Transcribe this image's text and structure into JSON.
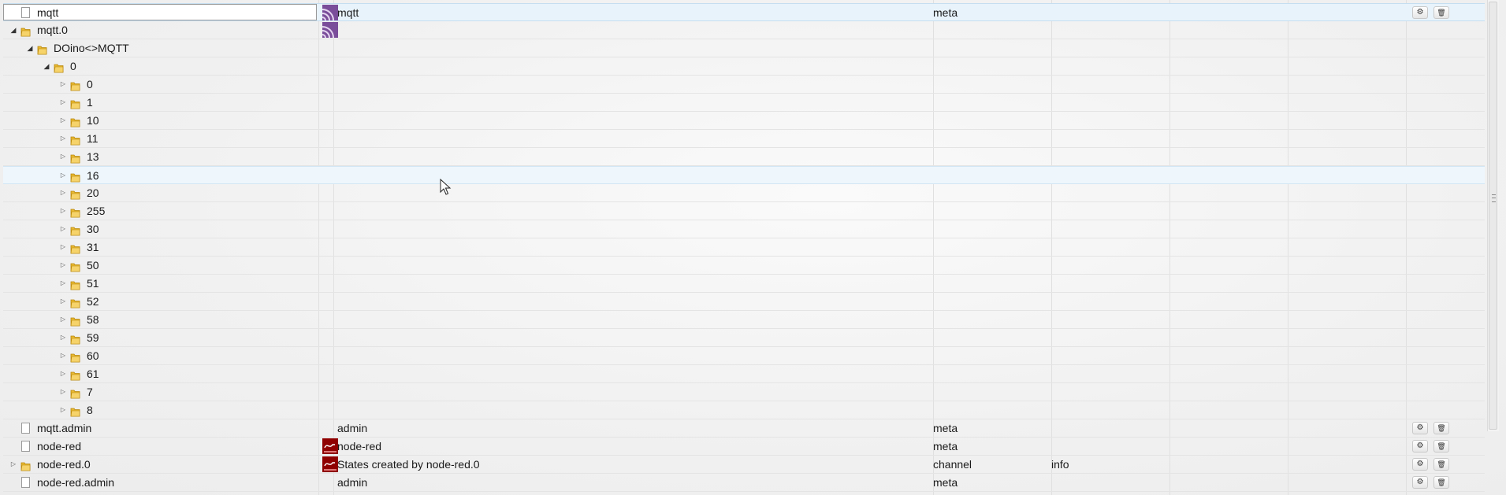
{
  "rows": [
    {
      "id": "mqtt",
      "name": "mqtt",
      "type": "meta",
      "role": "",
      "icon": "mqtt-adapter-icon",
      "kind": "file",
      "depth": 0,
      "expand": "none",
      "buttons": true,
      "state": "selected"
    },
    {
      "id": "mqtt.0",
      "name": "",
      "type": "",
      "role": "",
      "icon": "mqtt-adapter-icon",
      "kind": "folder",
      "depth": 0,
      "expand": "open",
      "buttons": false
    },
    {
      "id": "DOino<>MQTT",
      "name": "",
      "type": "",
      "role": "",
      "icon": "",
      "kind": "folder",
      "depth": 1,
      "expand": "open",
      "buttons": false
    },
    {
      "id": "0",
      "name": "",
      "type": "",
      "role": "",
      "icon": "",
      "kind": "folder",
      "depth": 2,
      "expand": "open",
      "buttons": false
    },
    {
      "id": "0",
      "kind": "folder",
      "depth": 3,
      "expand": "closed"
    },
    {
      "id": "1",
      "kind": "folder",
      "depth": 3,
      "expand": "closed"
    },
    {
      "id": "10",
      "kind": "folder",
      "depth": 3,
      "expand": "closed"
    },
    {
      "id": "11",
      "kind": "folder",
      "depth": 3,
      "expand": "closed"
    },
    {
      "id": "13",
      "kind": "folder",
      "depth": 3,
      "expand": "closed"
    },
    {
      "id": "16",
      "kind": "folder",
      "depth": 3,
      "expand": "closed",
      "state": "hover"
    },
    {
      "id": "20",
      "kind": "folder",
      "depth": 3,
      "expand": "closed"
    },
    {
      "id": "255",
      "kind": "folder",
      "depth": 3,
      "expand": "closed"
    },
    {
      "id": "30",
      "kind": "folder",
      "depth": 3,
      "expand": "closed"
    },
    {
      "id": "31",
      "kind": "folder",
      "depth": 3,
      "expand": "closed"
    },
    {
      "id": "50",
      "kind": "folder",
      "depth": 3,
      "expand": "closed"
    },
    {
      "id": "51",
      "kind": "folder",
      "depth": 3,
      "expand": "closed"
    },
    {
      "id": "52",
      "kind": "folder",
      "depth": 3,
      "expand": "closed"
    },
    {
      "id": "58",
      "kind": "folder",
      "depth": 3,
      "expand": "closed"
    },
    {
      "id": "59",
      "kind": "folder",
      "depth": 3,
      "expand": "closed"
    },
    {
      "id": "60",
      "kind": "folder",
      "depth": 3,
      "expand": "closed"
    },
    {
      "id": "61",
      "kind": "folder",
      "depth": 3,
      "expand": "closed"
    },
    {
      "id": "7",
      "kind": "folder",
      "depth": 3,
      "expand": "closed"
    },
    {
      "id": "8",
      "kind": "folder",
      "depth": 3,
      "expand": "closed"
    },
    {
      "id": "mqtt.admin",
      "name": "admin",
      "type": "meta",
      "role": "",
      "icon": "",
      "kind": "file",
      "depth": 0,
      "expand": "none",
      "buttons": true
    },
    {
      "id": "node-red",
      "name": "node-red",
      "type": "meta",
      "role": "",
      "icon": "node-red-icon",
      "kind": "file",
      "depth": 0,
      "expand": "none",
      "buttons": true
    },
    {
      "id": "node-red.0",
      "name": "States created by node-red.0",
      "type": "channel",
      "role": "info",
      "icon": "node-red-icon",
      "kind": "folder",
      "depth": 0,
      "expand": "closed",
      "buttons": true
    },
    {
      "id": "node-red.admin",
      "name": "admin",
      "type": "meta",
      "role": "",
      "icon": "",
      "kind": "file",
      "depth": 0,
      "expand": "none",
      "buttons": true
    }
  ],
  "icons": {
    "edit": "gear-icon",
    "delete": "trash-icon",
    "expand_closed": "▷",
    "expand_open": "◢"
  }
}
